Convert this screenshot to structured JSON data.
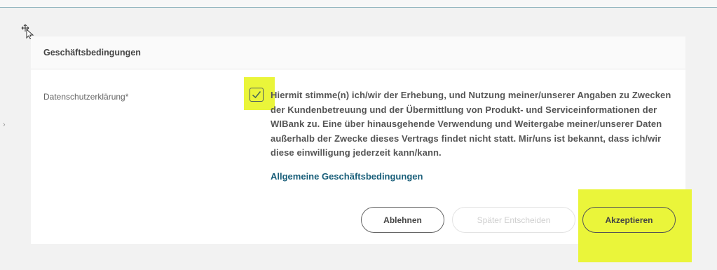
{
  "panel": {
    "title": "Geschäftsbedingungen",
    "field_label": "Datenschutzerklärung*",
    "consent_text": "Hiermit stimme(n) ich/wir der Erhebung, und Nutzung meiner/unserer Angaben zu Zwecken der Kundenbetreuung und der Übermittlung von Produkt- und Serviceinformationen der WIBank zu. Eine über hinausgehende Verwendung und Weitergabe meiner/unserer Daten außerhalb der Zwecke dieses Vertrags findet nicht statt. Mir/uns ist bekannt, dass ich/wir diese einwilligung jederzeit kann/kann.",
    "consent_checked": true,
    "link_label": "Allgemeine Geschäftsbedingungen"
  },
  "buttons": {
    "decline": "Ablehnen",
    "later": "Später Entscheiden",
    "accept": "Akzeptieren"
  },
  "colors": {
    "highlight": "#eaf53a",
    "link": "#1a5f7a",
    "background": "#f2f2f2"
  },
  "icons": {
    "cursor": "move-cursor-icon",
    "checkbox": "checkmark-icon"
  }
}
